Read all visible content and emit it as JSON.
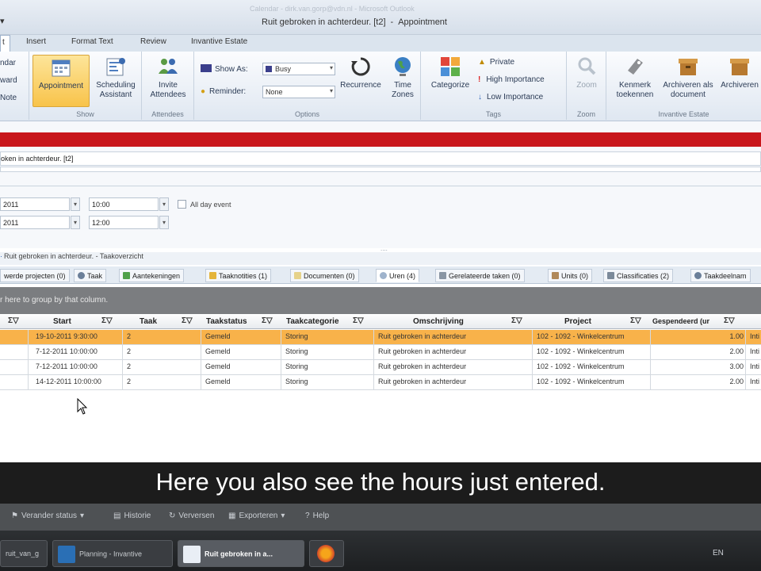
{
  "window": {
    "ghost_title": "Calendar - dirk.van.gorp@vdn.nl - Microsoft Outlook",
    "qat_glyph": "▾",
    "title": "Ruit gebroken in achterdeur. [t2]",
    "app_name": "Appointment",
    "title_sep": "-"
  },
  "ribbon_tabs": [
    "t",
    "Insert",
    "Format Text",
    "Review",
    "Invantive Estate"
  ],
  "ribbon": {
    "left_items": [
      "ndar",
      "ward",
      "Note"
    ],
    "show": {
      "label": "Show",
      "appointment": "Appointment",
      "scheduling": "Scheduling Assistant"
    },
    "attendees": {
      "label": "Attendees",
      "invite": "Invite Attendees"
    },
    "options": {
      "label": "Options",
      "show_as_label": "Show As:",
      "show_as_value": "Busy",
      "reminder_label": "Reminder:",
      "reminder_value": "None",
      "recurrence": "Recurrence",
      "time_zones": "Time Zones"
    },
    "tags": {
      "label": "Tags",
      "categorize": "Categorize",
      "private": "Private",
      "high": "High Importance",
      "low": "Low Importance"
    },
    "zoom": {
      "label": "Zoom",
      "zoom": "Zoom"
    },
    "invantive": {
      "label": "Invantive Estate",
      "kenmerk": "Kenmerk toekennen",
      "archiveren_doc": "Archiveren als document",
      "archiveren": "Archiveren"
    }
  },
  "form": {
    "subject": "oken in achterdeur. [t2]",
    "start_date": "2011",
    "start_time": "10:00",
    "end_date": "2011",
    "end_time": "12:00",
    "all_day_label": "All day event"
  },
  "panel": {
    "grip": "....",
    "title": "Ruit gebroken in achterdeur. - Taakoverzicht",
    "tabs": [
      {
        "label": "werde projecten (0)"
      },
      {
        "label": "Taak"
      },
      {
        "label": "Aantekeningen"
      },
      {
        "label": "Taaknotities (1)"
      },
      {
        "label": "Documenten (0)"
      },
      {
        "label": "Uren (4)"
      },
      {
        "label": "Gerelateerde taken (0)"
      },
      {
        "label": "Units (0)"
      },
      {
        "label": "Classificaties (2)"
      },
      {
        "label": "Taakdeelnam"
      }
    ],
    "group_hint": "r here to group by that column.",
    "columns": [
      "Start",
      "Taak",
      "Taakstatus",
      "Taakcategorie",
      "Omschrijving",
      "Project",
      "Gespendeerd (ur"
    ],
    "sigma": "Σ▽",
    "rows": [
      {
        "start": "19-10-2011 9:30:00",
        "taak": "2",
        "status": "Gemeld",
        "categorie": "Storing",
        "omschrijving": "Ruit gebroken in achterdeur",
        "project": "102 - 1092 - Winkelcentrum",
        "uren": "1.00",
        "extra": "Inti"
      },
      {
        "start": "7-12-2011 10:00:00",
        "taak": "2",
        "status": "Gemeld",
        "categorie": "Storing",
        "omschrijving": "Ruit gebroken in achterdeur",
        "project": "102 - 1092 - Winkelcentrum",
        "uren": "2.00",
        "extra": "Inti"
      },
      {
        "start": "7-12-2011 10:00:00",
        "taak": "2",
        "status": "Gemeld",
        "categorie": "Storing",
        "omschrijving": "Ruit gebroken in achterdeur",
        "project": "102 - 1092 - Winkelcentrum",
        "uren": "3.00",
        "extra": "Inti"
      },
      {
        "start": "14-12-2011 10:00:00",
        "taak": "2",
        "status": "Gemeld",
        "categorie": "Storing",
        "omschrijving": "Ruit gebroken in achterdeur",
        "project": "102 - 1092 - Winkelcentrum",
        "uren": "2.00",
        "extra": "Inti"
      }
    ]
  },
  "subtitle": "Here you also see the hours just entered.",
  "bottom_toolbar": [
    "Verander status",
    "Historie",
    "Verversen",
    "Exporteren",
    "Help"
  ],
  "taskbar": {
    "items": [
      "ruit_van_g",
      "Planning - Invantive",
      "Ruit gebroken in a..."
    ],
    "lang": "EN"
  },
  "colors": {
    "accent_red": "#c8161b",
    "selected_row": "#f8b24a",
    "ribbon_selected": "#f8c34a"
  }
}
